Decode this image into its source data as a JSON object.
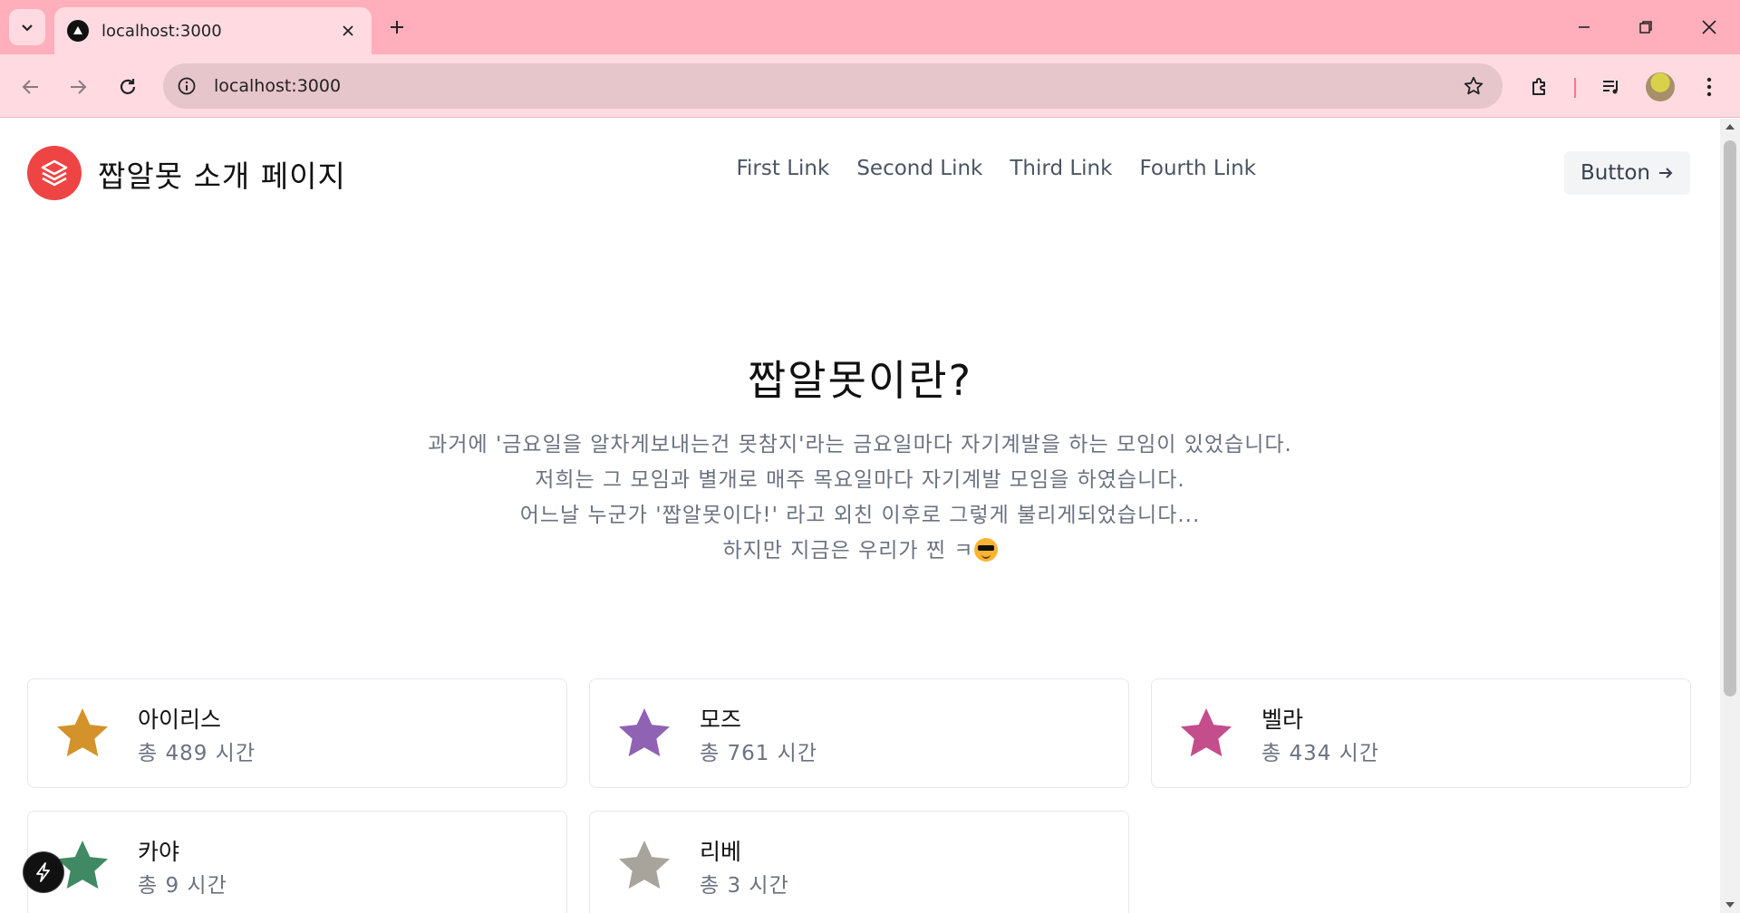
{
  "browser": {
    "tab_title": "localhost:3000",
    "url": "localhost:3000"
  },
  "header": {
    "brand": "짭알못 소개 페이지",
    "nav_links": [
      "First Link",
      "Second Link",
      "Third Link",
      "Fourth Link"
    ],
    "button_label": "Button"
  },
  "hero": {
    "title": "짭알못이란?",
    "lines": [
      "과거에 '금요일을 알차게보내는건 못참지'라는 금요일마다 자기계발을 하는 모임이 있었습니다.",
      "저희는 그 모임과 별개로 매주 목요일마다 자기계발 모임을 하였습니다.",
      "어느날 누군가 '짭알못이다!' 라고 외친 이후로 그렇게 불리게되었습니다...",
      "하지만 지금은 우리가 찐 ㅋ"
    ]
  },
  "members": [
    {
      "name": "아이리스",
      "hours": "총 489 시간",
      "color": "#d4922b"
    },
    {
      "name": "모즈",
      "hours": "총 761 시간",
      "color": "#8f62b3"
    },
    {
      "name": "벨라",
      "hours": "총 434 시간",
      "color": "#c44d8c"
    },
    {
      "name": "카야",
      "hours": "총 9 시간",
      "color": "#3f8a64"
    },
    {
      "name": "리베",
      "hours": "총 3 시간",
      "color": "#a8a49c"
    }
  ]
}
